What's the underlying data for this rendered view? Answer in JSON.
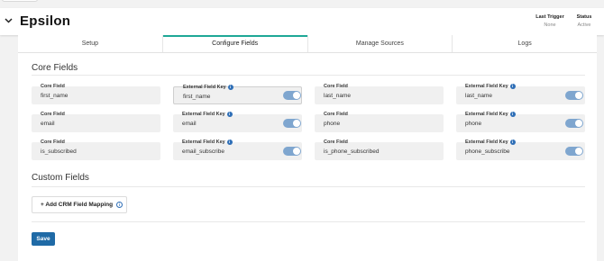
{
  "header": {
    "logo": "Epsilon",
    "last_trigger_label": "Last Trigger",
    "last_trigger_value": "None",
    "status_label": "Status",
    "status_value": "Active"
  },
  "tabs": [
    {
      "label": "Setup",
      "active": false
    },
    {
      "label": "Configure Fields",
      "active": true
    },
    {
      "label": "Manage Sources",
      "active": false
    },
    {
      "label": "Logs",
      "active": false
    }
  ],
  "core_fields": {
    "title": "Core Fields",
    "core_label": "Core Field",
    "external_label": "External Field Key",
    "info_icon": "i",
    "rows": [
      [
        {
          "core": "first_name",
          "external": "first_name",
          "enabled": true
        },
        {
          "core": "last_name",
          "external": "last_name",
          "enabled": true
        }
      ],
      [
        {
          "core": "email",
          "external": "email",
          "enabled": true
        },
        {
          "core": "phone",
          "external": "phone",
          "enabled": true
        }
      ],
      [
        {
          "core": "is_subscribed",
          "external": "email_subscribe",
          "enabled": true
        },
        {
          "core": "is_phone_subscribed",
          "external": "phone_subscribe",
          "enabled": true
        }
      ]
    ]
  },
  "custom_fields": {
    "title": "Custom Fields",
    "add_button": "+ Add CRM Field Mapping",
    "info_icon": "i"
  },
  "actions": {
    "save": "Save"
  },
  "colors": {
    "accent": "#1ea896",
    "primary": "#1f6aa6",
    "toggle_on": "#7fa6cf"
  }
}
